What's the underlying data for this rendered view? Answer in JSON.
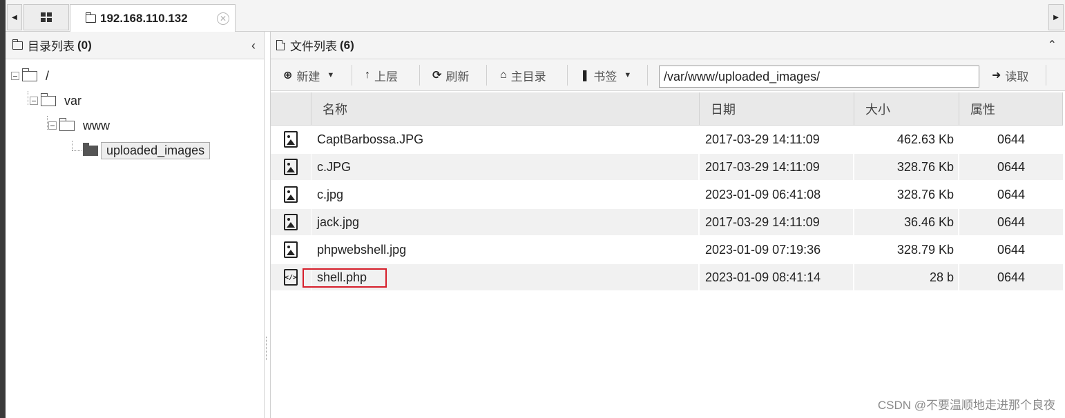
{
  "tabbar": {
    "scroll_left": "◀",
    "scroll_right": "▶",
    "active_tab_title": "192.168.110.132",
    "close_glyph": "✕"
  },
  "left_panel": {
    "title": "目录列表",
    "count": "(0)",
    "collapse_glyph": "‹",
    "tree": {
      "root": "/",
      "var": "var",
      "www": "www",
      "selected": "uploaded_images"
    }
  },
  "right_panel": {
    "title": "文件列表",
    "count": "(6)",
    "collapse_glyph": "⌃",
    "toolbar": {
      "new_label": "新建",
      "up_label": "上层",
      "refresh_label": "刷新",
      "home_label": "主目录",
      "bookmark_label": "书签",
      "path_value": "/var/www/uploaded_images/",
      "read_label": "读取"
    },
    "columns": {
      "name": "名称",
      "date": "日期",
      "size": "大小",
      "attr": "属性"
    },
    "files": [
      {
        "name": "CaptBarbossa.JPG",
        "date": "2017-03-29 14:11:09",
        "size": "462.63 Kb",
        "attr": "0644",
        "icon": "image-file-icon"
      },
      {
        "name": "c.JPG",
        "date": "2017-03-29 14:11:09",
        "size": "328.76 Kb",
        "attr": "0644",
        "icon": "image-file-icon"
      },
      {
        "name": "c.jpg",
        "date": "2023-01-09 06:41:08",
        "size": "328.76 Kb",
        "attr": "0644",
        "icon": "image-file-icon"
      },
      {
        "name": "jack.jpg",
        "date": "2017-03-29 14:11:09",
        "size": "36.46 Kb",
        "attr": "0644",
        "icon": "image-file-icon"
      },
      {
        "name": "phpwebshell.jpg",
        "date": "2023-01-09 07:19:36",
        "size": "328.79 Kb",
        "attr": "0644",
        "icon": "image-file-icon"
      },
      {
        "name": "shell.php",
        "date": "2023-01-09 08:41:14",
        "size": "28 b",
        "attr": "0644",
        "icon": "code-file-icon"
      }
    ]
  },
  "colors": {
    "highlight": "#d61e2a",
    "header_bg": "#f4f4f4",
    "row_alt_bg": "#f1f1f1"
  },
  "watermark": "CSDN @不要温顺地走进那个良夜"
}
